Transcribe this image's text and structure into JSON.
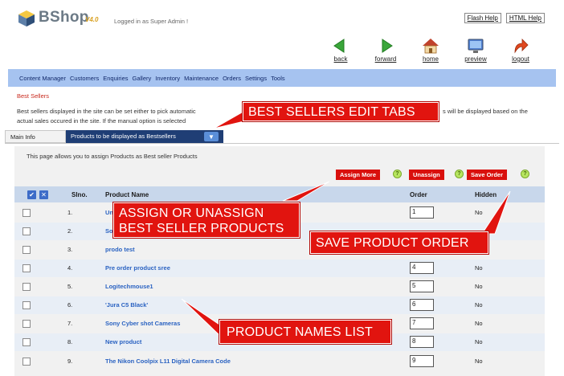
{
  "header": {
    "brand": "BShop",
    "version": "V4.0",
    "logged_in": "Logged in as Super Admin !",
    "links": [
      "Flash Help",
      "HTML Help"
    ]
  },
  "nav_icons": [
    {
      "label": "back",
      "icon": "back-arrow-icon"
    },
    {
      "label": "forward",
      "icon": "forward-arrow-icon"
    },
    {
      "label": "home",
      "icon": "home-icon"
    },
    {
      "label": "preview",
      "icon": "monitor-icon"
    },
    {
      "label": "logout",
      "icon": "logout-icon"
    }
  ],
  "menu": [
    "Content Manager",
    "Customers",
    "Enquiries",
    "Gallery",
    "Inventory",
    "Maintenance",
    "Orders",
    "Settings",
    "Tools"
  ],
  "breadcrumb": "Best Sellers",
  "description": {
    "left": "Best sellers displayed in the site can be set either to pick automatic",
    "right": "s will be displayed based on the",
    "line2": "actual sales occured in the site. If the manual option is selected"
  },
  "tabs": {
    "main": "Main Info",
    "select": "Products to be displayed as Bestsellers"
  },
  "info": "This page allows you to assign Products as Best seller Products",
  "buttons": {
    "assign_more": "Assign More",
    "unassign": "Unassign",
    "save_order": "Save Order",
    "help": "?"
  },
  "table": {
    "headers": {
      "slno": "Slno.",
      "product_name": "Product Name",
      "order": "Order",
      "hidden": "Hidden"
    },
    "rows": [
      {
        "slno": "1.",
        "name": "Un",
        "order": "1",
        "hidden": "No"
      },
      {
        "slno": "2.",
        "name": "So",
        "order": "",
        "hidden": ""
      },
      {
        "slno": "3.",
        "name": "prodo test",
        "order": "",
        "hidden": ""
      },
      {
        "slno": "4.",
        "name": "Pre order product sree",
        "order": "4",
        "hidden": "No"
      },
      {
        "slno": "5.",
        "name": "Logitechmouse1",
        "order": "5",
        "hidden": "No"
      },
      {
        "slno": "6.",
        "name": "'Jura C5 Black'",
        "order": "6",
        "hidden": "No"
      },
      {
        "slno": "7.",
        "name": "Sony Cyber shot Cameras",
        "order": "7",
        "hidden": "No"
      },
      {
        "slno": "8.",
        "name": "New product",
        "order": "8",
        "hidden": "No"
      },
      {
        "slno": "9.",
        "name": "The Nikon Coolpix L11 Digital Camera Code",
        "order": "9",
        "hidden": "No"
      }
    ]
  },
  "callouts": {
    "edit_tabs": "BEST SELLERS  EDIT TABS",
    "assign_line1": "ASSIGN OR UNASSIGN",
    "assign_line2": "BEST SELLER PRODUCTS",
    "save_order": "SAVE PRODUCT ORDER",
    "names_list": "PRODUCT NAMES LIST"
  },
  "colors": {
    "callout": "#e1140f",
    "menubar": "#a6c3f0",
    "tab_active": "#1f3e75",
    "header_row": "#c8d7eb"
  }
}
